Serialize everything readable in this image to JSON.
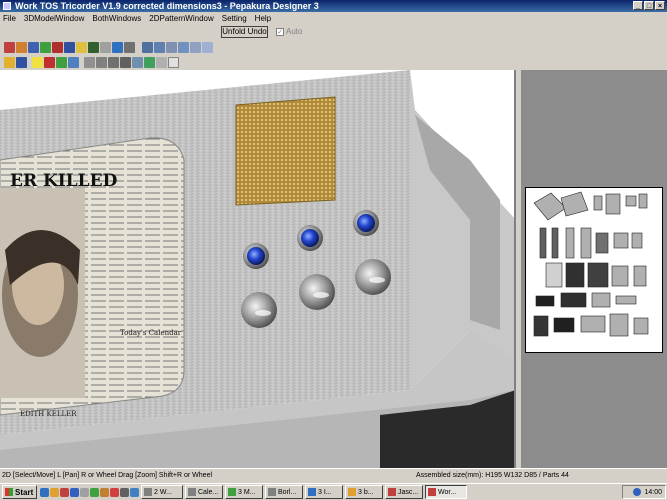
{
  "window": {
    "title": "Work TOS Tricorder V1.9 corrected dimensions3 - Pepakura Designer 3"
  },
  "menu": [
    "File",
    "3DModelWindow",
    "BothWindows",
    "2DPatternWindow",
    "Setting",
    "Help"
  ],
  "unfold": {
    "undo_label": "Unfold Undo",
    "auto_label": "Auto",
    "auto_checked": true
  },
  "toolbar1": [
    "select-icon",
    "pan-icon",
    "edit-icon",
    "join-icon",
    "paint-icon",
    "texture-icon",
    "shade-icon",
    "flap-icon",
    "cut-icon",
    "rotate-icon",
    "undo-icon",
    "fit-icon",
    "view-icon",
    "layout-icon",
    "page-icon",
    "print-icon",
    "window-icon"
  ],
  "toolbar2": [
    "open-icon",
    "save-icon",
    "light-icon",
    "cube-icon",
    "move-icon",
    "fold-icon",
    "edge-icon",
    "line-icon",
    "pencil-icon",
    "anchor-icon",
    "link-icon",
    "color-icon",
    "frame-icon",
    "sheet-icon"
  ],
  "newspaper": {
    "headline": "ER KILLED",
    "caption1": "Today's Calendar",
    "caption2": "EDITH KELLER"
  },
  "status": {
    "left": "2D [Select/Move] L [Pan] R or Wheel Drag [Zoom] Shift+R or Wheel",
    "right": "Assembled size(mm): H195 W132 D85 / Parts 44"
  },
  "taskbar": {
    "start_label": "Start",
    "tasks": [
      "2 W...",
      "Cale...",
      "3 M...",
      "Borl...",
      "3 I...",
      "3 b...",
      "Jasc...",
      "Wor..."
    ],
    "clock": "14:00"
  },
  "colors": {
    "titlebar": "#0a246a",
    "panel_gray": "#d4d0c8",
    "knob_blue": "#2244cc"
  }
}
